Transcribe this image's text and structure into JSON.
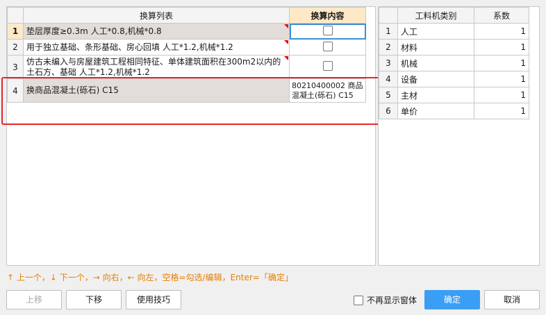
{
  "left_table": {
    "headers": {
      "list": "换算列表",
      "content": "换算内容"
    },
    "rows": [
      {
        "num": "1",
        "desc": "垫层厚度≥0.3m 人工*0.8,机械*0.8",
        "content": ""
      },
      {
        "num": "2",
        "desc": "用于独立基础、条形基础、房心回填 人工*1.2,机械*1.2",
        "content": ""
      },
      {
        "num": "3",
        "desc": "仿古未编入与房屋建筑工程相同特征、单体建筑面积在300m2以内的土石方、基础 人工*1.2,机械*1.2",
        "content": ""
      },
      {
        "num": "4",
        "desc": "换商品混凝土(砾石) C15",
        "content": "80210400002  商品混凝土(砾石) C15"
      }
    ]
  },
  "right_table": {
    "headers": {
      "category": "工料机类别",
      "coef": "系数"
    },
    "rows": [
      {
        "num": "1",
        "name": "人工",
        "value": "1"
      },
      {
        "num": "2",
        "name": "材料",
        "value": "1"
      },
      {
        "num": "3",
        "name": "机械",
        "value": "1"
      },
      {
        "num": "4",
        "name": "设备",
        "value": "1"
      },
      {
        "num": "5",
        "name": "主材",
        "value": "1"
      },
      {
        "num": "6",
        "name": "单价",
        "value": "1"
      }
    ]
  },
  "hint": "↑ 上一个，↓ 下一个，→ 向右，← 向左，空格=勾选/编辑，Enter=「确定」",
  "buttons": {
    "move_up": "上移",
    "move_down": "下移",
    "tips": "使用技巧",
    "no_show": "不再显示窗体",
    "ok": "确定",
    "cancel": "取消"
  },
  "colors": {
    "accent": "#3b9ef5",
    "highlight": "#e32727",
    "hint": "#e67e00"
  }
}
